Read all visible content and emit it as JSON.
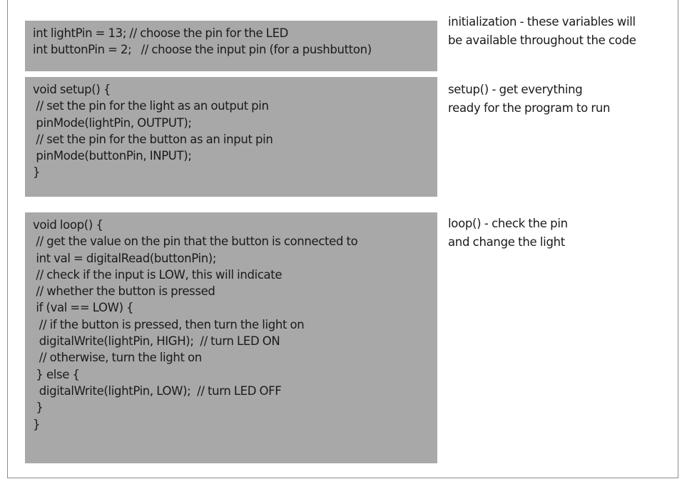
{
  "code_blocks": {
    "init": {
      "lines": [
        "int lightPin = 13; // choose the pin for the LED",
        "int buttonPin = 2;   // choose the input pin (for a pushbutton)"
      ]
    },
    "setup": {
      "lines": [
        "void setup() {",
        " // set the pin for the light as an output pin",
        " pinMode(lightPin, OUTPUT);",
        " // set the pin for the button as an input pin",
        " pinMode(buttonPin, INPUT);",
        "}"
      ]
    },
    "loop": {
      "lines": [
        "void loop() {",
        " // get the value on the pin that the button is connected to",
        " int val = digitalRead(buttonPin);",
        " // check if the input is LOW, this will indicate",
        " // whether the button is pressed",
        " if (val == LOW) {",
        "  // if the button is pressed, then turn the light on",
        "  digitalWrite(lightPin, HIGH);  // turn LED ON",
        "  // otherwise, turn the light on",
        " } else {",
        "  digitalWrite(lightPin, LOW);  // turn LED OFF",
        " }",
        "}"
      ]
    }
  },
  "annotations": {
    "init": {
      "lines": [
        "initialization - these variables will",
        "be available throughout the code"
      ]
    },
    "setup": {
      "lines": [
        "setup() - get everything",
        "ready for the program to run"
      ]
    },
    "loop": {
      "lines": [
        "loop() - check the pin",
        "and change the light"
      ]
    }
  },
  "colors": {
    "code_background": "#a8a8a8",
    "text": "#1a1a1a",
    "frame_border": "#8c8c8c"
  }
}
